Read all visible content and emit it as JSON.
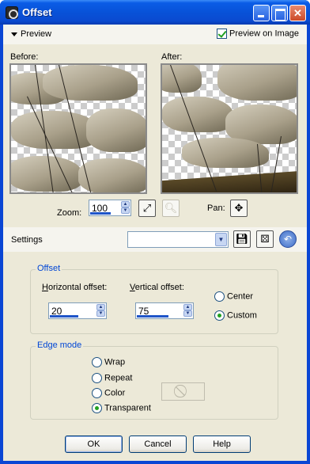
{
  "window": {
    "title": "Offset"
  },
  "preview": {
    "toggle_label": "Preview",
    "preview_on_image_label": "Preview on Image",
    "preview_on_image_checked": true,
    "before_label": "Before:",
    "after_label": "After:"
  },
  "zoom": {
    "label": "Zoom:",
    "value": "100"
  },
  "pan": {
    "label": "Pan:"
  },
  "settings": {
    "label": "Settings",
    "preset_value": ""
  },
  "offset": {
    "group_title": "Offset",
    "horizontal_label_u": "H",
    "horizontal_label_rest": "orizontal offset:",
    "horizontal_value": "20",
    "vertical_label_u": "V",
    "vertical_label_rest": "ertical offset:",
    "vertical_value": "75",
    "center_label": "Center",
    "custom_label": "Custom",
    "selected": "custom"
  },
  "edge_mode": {
    "group_title": "Edge mode",
    "wrap_label": "Wrap",
    "repeat_label": "Repeat",
    "color_label": "Color",
    "transparent_label": "Transparent",
    "selected": "transparent"
  },
  "buttons": {
    "ok": "OK",
    "cancel": "Cancel",
    "help": "Help"
  },
  "colors": {
    "title_bar": "#0852d8",
    "client_bg": "#ece9d8",
    "group_title": "#0046d5",
    "radio_check": "#21a121"
  }
}
